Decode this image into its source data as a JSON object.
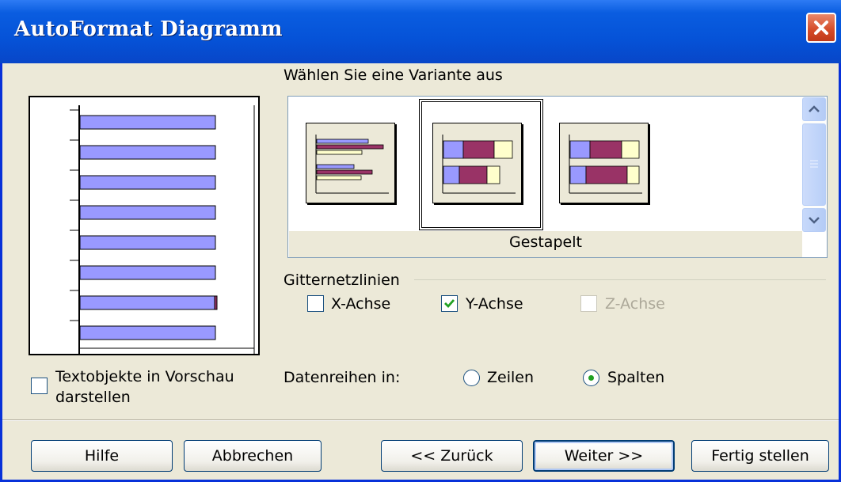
{
  "window": {
    "title": "AutoFormat Diagramm"
  },
  "variants": {
    "label": "Wählen Sie eine Variante aus",
    "selected_name": "Gestapelt"
  },
  "gridlines": {
    "label": "Gitternetzlinien",
    "x_axis": {
      "label": "X-Achse",
      "checked": false,
      "enabled": true
    },
    "y_axis": {
      "label": "Y-Achse",
      "checked": true,
      "enabled": true
    },
    "z_axis": {
      "label": "Z-Achse",
      "checked": false,
      "enabled": false
    }
  },
  "preview_option": {
    "line1": "Textobjekte in Vorschau",
    "line2": "darstellen",
    "checked": false
  },
  "series": {
    "label": "Datenreihen in:",
    "rows": {
      "label": "Zeilen",
      "selected": false
    },
    "columns": {
      "label": "Spalten",
      "selected": true
    }
  },
  "buttons": {
    "help": "Hilfe",
    "cancel": "Abbrechen",
    "back": "<< Zurück",
    "next": "Weiter >>",
    "finish": "Fertig stellen"
  },
  "colors": {
    "titlebar": "#0553d8",
    "bar_blue": "#9999ff",
    "bar_maroon": "#993366",
    "bar_cream": "#ffffcc",
    "check_green": "#21a121"
  }
}
